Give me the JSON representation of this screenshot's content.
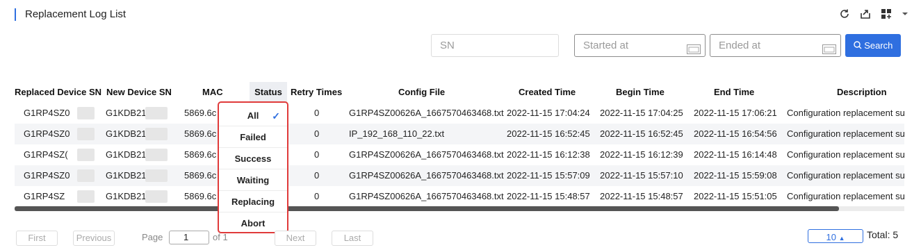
{
  "page": {
    "title": "Replacement Log List"
  },
  "toolbar": {
    "icons": [
      "refresh-icon",
      "export-icon",
      "grid-add-icon",
      "chevron-down-icon"
    ]
  },
  "filters": {
    "sn_placeholder": "SN",
    "started_placeholder": "Started at",
    "ended_placeholder": "Ended at",
    "search_label": "Search"
  },
  "table": {
    "headers": {
      "replaced_sn": "Replaced Device SN",
      "new_sn": "New Device SN",
      "mac": "MAC",
      "status": "Status",
      "retry": "Retry Times",
      "config": "Config File",
      "created": "Created Time",
      "begin": "Begin Time",
      "end": "End Time",
      "desc": "Description"
    },
    "rows": [
      {
        "replaced_sn": "G1RP4SZ0",
        "new_sn": "G1KDB21(",
        "mac": "5869.6c",
        "retry": "0",
        "config": "G1RP4SZ00626A_1667570463468.txt",
        "created": "2022-11-15 17:04:24",
        "begin": "2022-11-15 17:04:25",
        "end": "2022-11-15 17:06:21",
        "desc": "Configuration replacement su"
      },
      {
        "replaced_sn": "G1RP4SZ0",
        "new_sn": "G1KDB210",
        "mac": "5869.6c",
        "retry": "0",
        "config": "IP_192_168_110_22.txt",
        "created": "2022-11-15 16:52:45",
        "begin": "2022-11-15 16:52:45",
        "end": "2022-11-15 16:54:56",
        "desc": "Configuration replacement su"
      },
      {
        "replaced_sn": "G1RP4SZ(",
        "new_sn": "G1KDB21(",
        "mac": "5869.6c",
        "retry": "0",
        "config": "G1RP4SZ00626A_1667570463468.txt",
        "created": "2022-11-15 16:12:38",
        "begin": "2022-11-15 16:12:39",
        "end": "2022-11-15 16:14:48",
        "desc": "Configuration replacement su"
      },
      {
        "replaced_sn": "G1RP4SZ0",
        "new_sn": "G1KDB21",
        "mac": "5869.6c",
        "retry": "0",
        "config": "G1RP4SZ00626A_1667570463468.txt",
        "created": "2022-11-15 15:57:09",
        "begin": "2022-11-15 15:57:10",
        "end": "2022-11-15 15:59:08",
        "desc": "Configuration replacement su"
      },
      {
        "replaced_sn": "G1RP4SZ",
        "new_sn": "G1KDB21(",
        "mac": "5869.6c",
        "retry": "0",
        "config": "G1RP4SZ00626A_1667570463468.txt",
        "created": "2022-11-15 15:48:57",
        "begin": "2022-11-15 15:48:57",
        "end": "2022-11-15 15:51:05",
        "desc": "Configuration replacement su"
      }
    ]
  },
  "status_dropdown": {
    "options": [
      "All",
      "Failed",
      "Success",
      "Waiting",
      "Replacing",
      "Abort"
    ],
    "selected": "All"
  },
  "pagination": {
    "first": "First",
    "previous": "Previous",
    "page_label": "Page",
    "page_value": "1",
    "of_label": "of 1",
    "next": "Next",
    "last": "Last",
    "page_size": "10",
    "total": "Total: 5"
  },
  "colors": {
    "accent": "#2f6fe0",
    "highlight_border": "#e03a3a"
  }
}
